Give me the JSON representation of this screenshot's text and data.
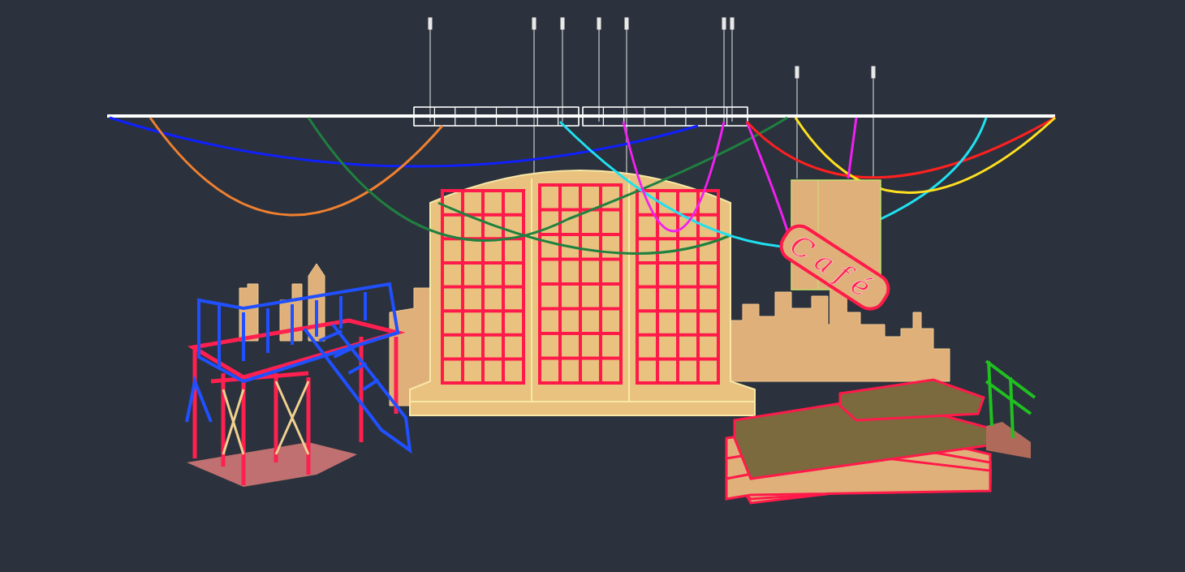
{
  "viewport": {
    "sign": {
      "text": "Café"
    }
  }
}
